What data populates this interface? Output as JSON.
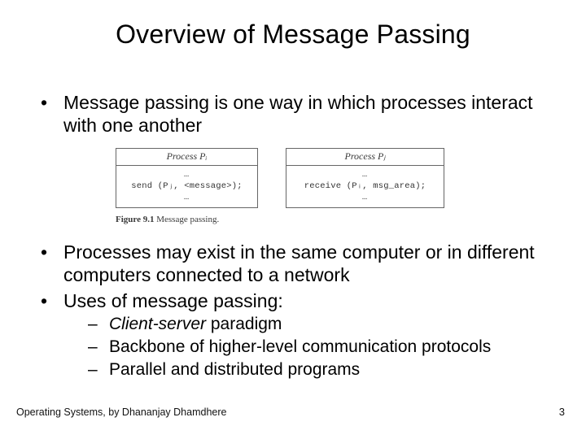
{
  "title": "Overview of Message Passing",
  "bullets": {
    "b1": "Message passing is one way in which processes interact with one another",
    "b2": "Processes may exist in the same computer or in different computers connected to a network",
    "b3": "Uses of message passing:",
    "sub1_ital": "Client-server",
    "sub1_rest": " paradigm",
    "sub2": "Backbone of higher-level communication protocols",
    "sub3": "Parallel and distributed programs"
  },
  "figure": {
    "left_head": "Process Pᵢ",
    "left_ell": "…",
    "left_code": "send (Pⱼ, <message>);",
    "right_head": "Process Pⱼ",
    "right_ell": "…",
    "right_code": "receive (Pᵢ, msg_area);",
    "caption_bold": "Figure 9.1",
    "caption_rest": "  Message passing."
  },
  "footer": {
    "left": "Operating Systems, by Dhananjay Dhamdhere",
    "page": "3"
  }
}
